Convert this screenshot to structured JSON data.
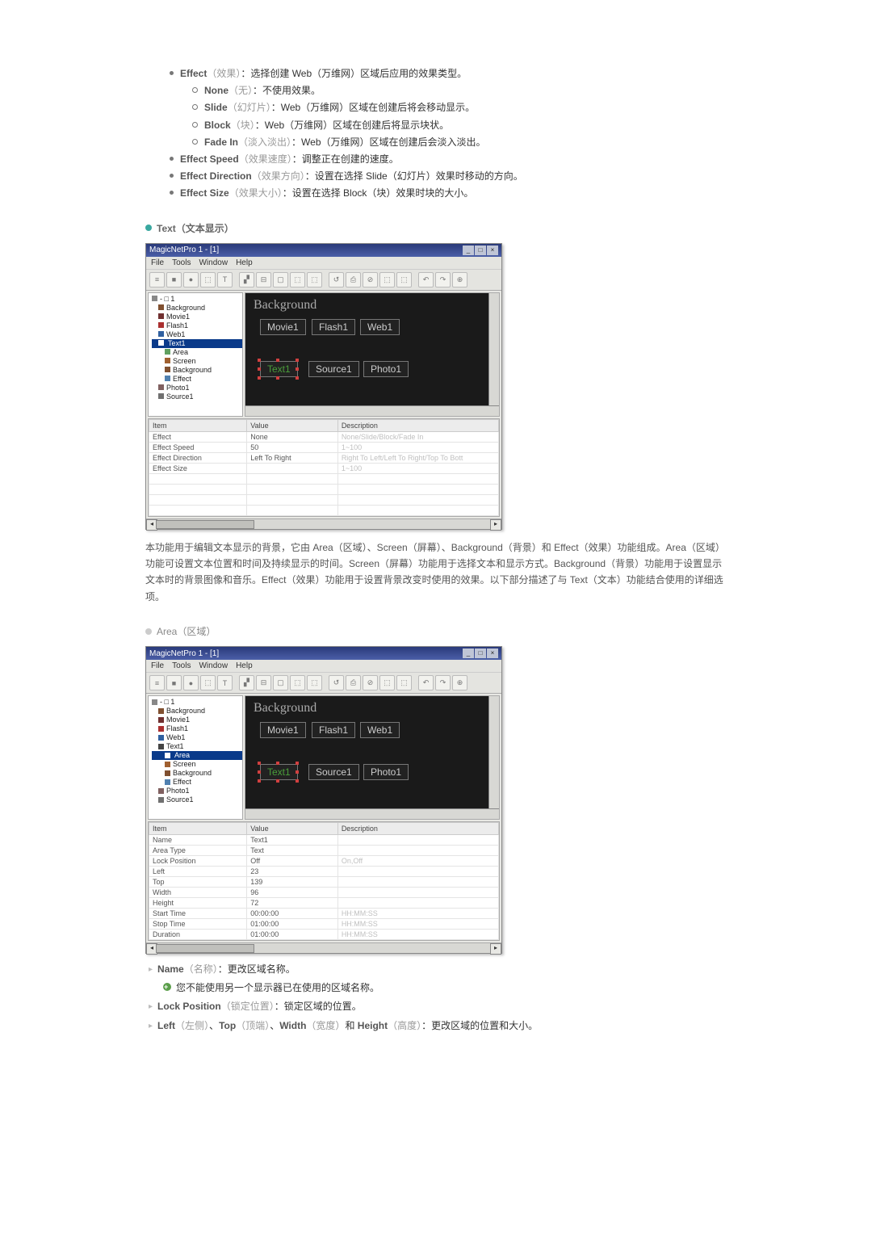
{
  "top_bullets": [
    {
      "label": "Effect",
      "gray": "（效果）",
      "rest": "：选择创建 Web（万维网）区域后应用的效果类型。",
      "sub": [
        {
          "label": "None",
          "gray": "（无）",
          "rest": "：不使用效果。"
        },
        {
          "label": "Slide",
          "gray": "（幻灯片）",
          "rest": "：Web（万维网）区域在创建后将会移动显示。"
        },
        {
          "label": "Block",
          "gray": "（块）",
          "rest": "：Web（万维网）区域在创建后将显示块状。"
        },
        {
          "label": "Fade In",
          "gray": "（淡入淡出）",
          "rest": "：Web（万维网）区域在创建后会淡入淡出。"
        }
      ]
    },
    {
      "label": "Effect Speed",
      "gray": "（效果速度）",
      "rest": "：调整正在创建的速度。"
    },
    {
      "label": "Effect Direction",
      "gray": "（效果方向）",
      "rest": "：设置在选择 Slide（幻灯片）效果时移动的方向。"
    },
    {
      "label": "Effect Size",
      "gray": "（效果大小）",
      "rest": "：设置在选择 Block（块）效果时块的大小。"
    }
  ],
  "section_text_title": "Text（文本显示）",
  "text_paragraph": "本功能用于编辑文本显示的背景，它由 Area（区域）、Screen（屏幕）、Background（背景）和 Effect（效果）功能组成。Area（区域）功能可设置文本位置和时间及持续显示的时间。Screen（屏幕）功能用于选择文本和显示方式。Background（背景）功能用于设置显示文本时的背景图像和音乐。Effect（效果）功能用于设置背景改变时使用的效果。以下部分描述了与 Text（文本）功能结合使用的详细选项。",
  "section_area_title": "Area（区域）",
  "bottom_items": [
    {
      "label": "Name",
      "gray": "（名称）",
      "rest": "：更改区域名称。",
      "note": "您不能使用另一个显示器已在使用的区域名称。"
    },
    {
      "label": "Lock Position",
      "gray": "（锁定位置）",
      "rest": "：锁定区域的位置。"
    },
    {
      "html": "<span class='bold'>Left</span><span class='gray'>（左侧）</span>、<span class='bold'>Top</span><span class='gray'>（顶端）</span>、<span class='bold'>Width</span><span class='gray'>（宽度）</span>和 <span class='bold'>Height</span><span class='gray'>（高度）</span>：更改区域的位置和大小。"
    }
  ],
  "window": {
    "title": "MagicNetPro 1 - [1]",
    "menus": [
      "File",
      "Tools",
      "Window",
      "Help"
    ],
    "canvas_title": "Background",
    "chips_row1": [
      "Movie1",
      "Flash1",
      "Web1"
    ],
    "chips_row2": [
      "Text1",
      "Source1",
      "Photo1"
    ],
    "tree1": [
      {
        "t": "-  □ 1",
        "cls": ""
      },
      {
        "t": "Background",
        "cls": "ind1",
        "c": "#805030"
      },
      {
        "t": "Movie1",
        "cls": "ind1",
        "c": "#703030"
      },
      {
        "t": "Flash1",
        "cls": "ind1",
        "c": "#aa3030"
      },
      {
        "t": "Web1",
        "cls": "ind1",
        "c": "#3060a0"
      },
      {
        "t": "Text1",
        "cls": "ind1 sel",
        "c": "#ffffff",
        "boxed": true
      },
      {
        "t": "Area",
        "cls": "ind2",
        "c": "#60a060"
      },
      {
        "t": "Screen",
        "cls": "ind2",
        "c": "#a06030"
      },
      {
        "t": "Background",
        "cls": "ind2",
        "c": "#805030"
      },
      {
        "t": "Effect",
        "cls": "ind2",
        "c": "#5080b0"
      },
      {
        "t": "Photo1",
        "cls": "ind1",
        "c": "#806060"
      },
      {
        "t": "Source1",
        "cls": "ind1",
        "c": "#707070"
      }
    ],
    "props1_headers": [
      "Item",
      "Value",
      "Description"
    ],
    "props1_rows": [
      [
        "Effect",
        "None",
        "None/Slide/Block/Fade In"
      ],
      [
        "Effect Speed",
        "50",
        "1~100"
      ],
      [
        "Effect Direction",
        "Left To Right",
        "Right To Left/Left To Right/Top To Bott"
      ],
      [
        "Effect Size",
        "",
        "1~100"
      ]
    ],
    "tree2": [
      {
        "t": "-  □ 1",
        "cls": ""
      },
      {
        "t": "Background",
        "cls": "ind1",
        "c": "#805030"
      },
      {
        "t": "Movie1",
        "cls": "ind1",
        "c": "#703030"
      },
      {
        "t": "Flash1",
        "cls": "ind1",
        "c": "#aa3030"
      },
      {
        "t": "Web1",
        "cls": "ind1",
        "c": "#3060a0"
      },
      {
        "t": "Text1",
        "cls": "ind1",
        "c": "#444"
      },
      {
        "t": "Area",
        "cls": "ind2 sel",
        "c": "#ffffff",
        "boxed": true
      },
      {
        "t": "Screen",
        "cls": "ind2",
        "c": "#a06030"
      },
      {
        "t": "Background",
        "cls": "ind2",
        "c": "#805030"
      },
      {
        "t": "Effect",
        "cls": "ind2",
        "c": "#5080b0"
      },
      {
        "t": "Photo1",
        "cls": "ind1",
        "c": "#806060"
      },
      {
        "t": "Source1",
        "cls": "ind1",
        "c": "#707070"
      }
    ],
    "props2_headers": [
      "Item",
      "Value",
      "Description"
    ],
    "props2_rows": [
      [
        "Name",
        "Text1",
        ""
      ],
      [
        "Area Type",
        "Text",
        ""
      ],
      [
        "Lock Position",
        "Off",
        "On,Off"
      ],
      [
        "Left",
        "23",
        ""
      ],
      [
        "Top",
        "139",
        ""
      ],
      [
        "Width",
        "96",
        ""
      ],
      [
        "Height",
        "72",
        ""
      ],
      [
        "Start Time",
        "00:00:00",
        "HH:MM:SS"
      ],
      [
        "Stop Time",
        "01:00:00",
        "HH:MM:SS"
      ],
      [
        "Duration",
        "01:00:00",
        "HH:MM:SS"
      ]
    ]
  },
  "toolbar_icons": [
    "≡",
    "■",
    "●",
    "⬚",
    "T",
    "▞",
    "⊟",
    "▢",
    "⬚",
    "⬚",
    "↺",
    "⎙",
    "⊘",
    "⬚",
    "⬚",
    "↶",
    "↷",
    "⊕"
  ]
}
